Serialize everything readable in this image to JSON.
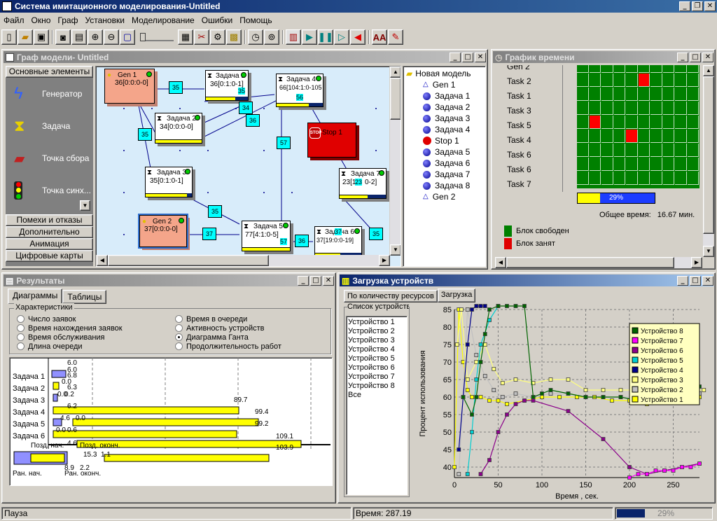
{
  "app": {
    "title": "Система имитационного моделирования-Untitled"
  },
  "menu": [
    "Файл",
    "Окно",
    "Граф",
    "Установки",
    "Моделирование",
    "Ошибки",
    "Помощь"
  ],
  "graph_window": {
    "title": "Граф модели- Untitled"
  },
  "palette": {
    "header": "Основные элементы",
    "items": [
      "Генератор",
      "Задача",
      "Точка сбора",
      "Точка синх..."
    ],
    "sections": [
      "Помехи и отказы",
      "Дополнительно",
      "Анимация",
      "Цифровые карты"
    ]
  },
  "nodes": [
    {
      "name": "Gen 1",
      "sub": "36[0:0:0-0]"
    },
    {
      "name": "Задача 1",
      "sub": "36[0:1:0-1]",
      "q": "35"
    },
    {
      "name": "Задача 4",
      "sub": "66[104:1:0-105",
      "q": "56"
    },
    {
      "name": "Задача 2",
      "sub": "34[0:0:0-0]"
    },
    {
      "name": "Stop 1",
      "sub": ""
    },
    {
      "name": "Задача 3",
      "sub": "35[0:1:0-1]"
    },
    {
      "name": "Задача 7",
      "sub": "23[1",
      "sub2": "23",
      "sub3": "0-2]"
    },
    {
      "name": "Gen 2",
      "sub": "37[0:0:0-0]"
    },
    {
      "name": "Задача 5",
      "sub": "77[4:1:0-5]",
      "q": "57"
    },
    {
      "name": "Задача 6",
      "sub": "37[19:0:0-19]",
      "q": "37",
      "q2": "37"
    }
  ],
  "edge_labels": [
    "35",
    "34",
    "36",
    "35",
    "57",
    "35",
    "37",
    "36",
    "35"
  ],
  "tree": {
    "root": "Новая модель",
    "items": [
      "Gen 1",
      "Задача 1",
      "Задача 2",
      "Задача 3",
      "Задача 4",
      "Stop 1",
      "Задача 5",
      "Задача 6",
      "Задача 7",
      "Задача 8",
      "Gen 2"
    ]
  },
  "time_window": {
    "title": "График времени",
    "rows": [
      "Gen 2",
      "Task 2",
      "Task 1",
      "Task 3",
      "Task 5",
      "Task 4",
      "Task 6",
      "Task 6",
      "Task 7"
    ],
    "progress": "29%",
    "progress_value": 0.29,
    "total_label": "Общее время:",
    "total_value": "16.67 мин.",
    "legend_free": "Блок свободен",
    "legend_busy": "Блок занят",
    "colors": {
      "free": "#008000",
      "busy": "#ff0000"
    }
  },
  "results_window": {
    "title": "Результаты",
    "tabs": [
      "Диаграммы",
      "Таблицы"
    ],
    "group": "Характеристики",
    "radios_left": [
      "Число заявок",
      "Время нахождения заявок",
      "Время обслуживания",
      "Длина очереди"
    ],
    "radios_right": [
      "Время в очереди",
      "Активность устройств",
      "Диаграмма Ганта",
      "Продолжительность работ"
    ],
    "selected": "Диаграмма Ганта",
    "gantt_rows": [
      "Задача 1",
      "Задача 2",
      "Задача 3",
      "Задача 4",
      "Задача 5",
      "Задача 6"
    ],
    "gantt_labels": [
      "6.0",
      "6.0",
      "6.8",
      "0.0",
      "6.3",
      "0.0",
      "0.2",
      "89.7",
      "6.2",
      "99.4",
      "4.6",
      "0.0",
      "99.2",
      "0.0",
      "0.6",
      "109.1",
      "4.6",
      "103.9",
      "15.3",
      "1.1",
      "8.9",
      "2.2"
    ],
    "legend": {
      "late_start": "Позд. нач.",
      "late_end": "Позд. оконч.",
      "early_start": "Ран. нач.",
      "early_end": "Ран. оконч."
    }
  },
  "load_window": {
    "title": "Загрузка устройств",
    "tabs": [
      "По количеству ресурсов",
      "Загрузка"
    ],
    "list_title": "Список устройств",
    "devices": [
      "Устройство 1",
      "Устройство 2",
      "Устройство 3",
      "Устройство 4",
      "Устройство 5",
      "Устройство 6",
      "Устройство 7",
      "Устройство 8",
      "Все"
    ]
  },
  "chart_data": {
    "type": "line",
    "xlabel": "Время , сек.",
    "ylabel": "Процент использования",
    "xlim": [
      0,
      280
    ],
    "ylim": [
      37,
      85
    ],
    "xticks": [
      0,
      50,
      100,
      150,
      200,
      250
    ],
    "yticks": [
      40,
      45,
      50,
      55,
      60,
      65,
      70,
      75,
      80,
      85
    ],
    "legend": [
      "Устройство 8",
      "Устройство 7",
      "Устройство 6",
      "Устройство 5",
      "Устройство 4",
      "Устройство 3",
      "Устройство 2",
      "Устройство 1"
    ],
    "series": [
      {
        "name": "Устройство 1",
        "color": "#ffff00",
        "x": [
          0,
          5,
          10,
          15,
          20,
          30,
          40,
          50,
          60,
          80,
          100,
          120,
          140,
          160,
          180,
          200,
          220,
          240,
          260,
          280
        ],
        "y": [
          40,
          85,
          70,
          62,
          60,
          60,
          59,
          59,
          58,
          59,
          60,
          60,
          60,
          60,
          59,
          59,
          58,
          59,
          59,
          60
        ]
      },
      {
        "name": "Устройство 2",
        "color": "#c0c0c0",
        "x": [
          5,
          15,
          25,
          35,
          45,
          55,
          70,
          90,
          110,
          130,
          150,
          170,
          190,
          210,
          230,
          250,
          270,
          280
        ],
        "y": [
          38,
          85,
          72,
          66,
          62,
          60,
          61,
          60,
          61,
          61,
          60,
          60,
          60,
          60,
          59,
          60,
          60,
          61
        ]
      },
      {
        "name": "Устройство 3",
        "color": "#ffff80",
        "x": [
          3,
          8,
          15,
          25,
          35,
          45,
          55,
          70,
          90,
          110,
          130,
          150,
          170,
          190,
          210,
          230,
          250,
          270,
          285
        ],
        "y": [
          75,
          85,
          65,
          70,
          75,
          68,
          64,
          65,
          64,
          65,
          65,
          62,
          62,
          62,
          62,
          61,
          61,
          62,
          62
        ]
      },
      {
        "name": "Устройство 4",
        "color": "#00008b",
        "x": [
          5,
          10,
          15,
          20,
          25,
          30,
          35
        ],
        "y": [
          45,
          60,
          75,
          85,
          86,
          86,
          86
        ]
      },
      {
        "name": "Устройство 5",
        "color": "#00ced1",
        "x": [
          15,
          20,
          25,
          30,
          40,
          50
        ],
        "y": [
          38,
          50,
          65,
          75,
          82,
          86
        ]
      },
      {
        "name": "Устройство 6",
        "color": "#8b008b",
        "x": [
          30,
          40,
          50,
          60,
          70,
          80,
          90,
          130,
          170,
          200,
          220,
          240,
          260,
          280
        ],
        "y": [
          38,
          42,
          50,
          55,
          58,
          59,
          59,
          56,
          48,
          40,
          38,
          39,
          40,
          41
        ]
      },
      {
        "name": "Устройство 7",
        "color": "#ff00ff",
        "x": [
          200,
          210,
          220,
          230,
          240,
          250,
          260,
          270,
          280
        ],
        "y": [
          37,
          38,
          38,
          39,
          39,
          39,
          40,
          40,
          41
        ]
      },
      {
        "name": "Устройство 8",
        "color": "#006400",
        "x": [
          10,
          20,
          25,
          30,
          35,
          40,
          50,
          60,
          70,
          80,
          90,
          100,
          110,
          130,
          150,
          170,
          190,
          210,
          230,
          250,
          260,
          270,
          280
        ],
        "y": [
          60,
          55,
          60,
          70,
          78,
          85,
          86,
          86,
          86,
          86,
          60,
          61,
          62,
          61,
          60,
          60,
          60,
          59,
          59,
          59,
          60,
          61,
          63
        ]
      }
    ]
  },
  "status": {
    "state": "Пауза",
    "time_label": "Время: 287.19",
    "progress": "29%",
    "progress_value": 0.29
  }
}
